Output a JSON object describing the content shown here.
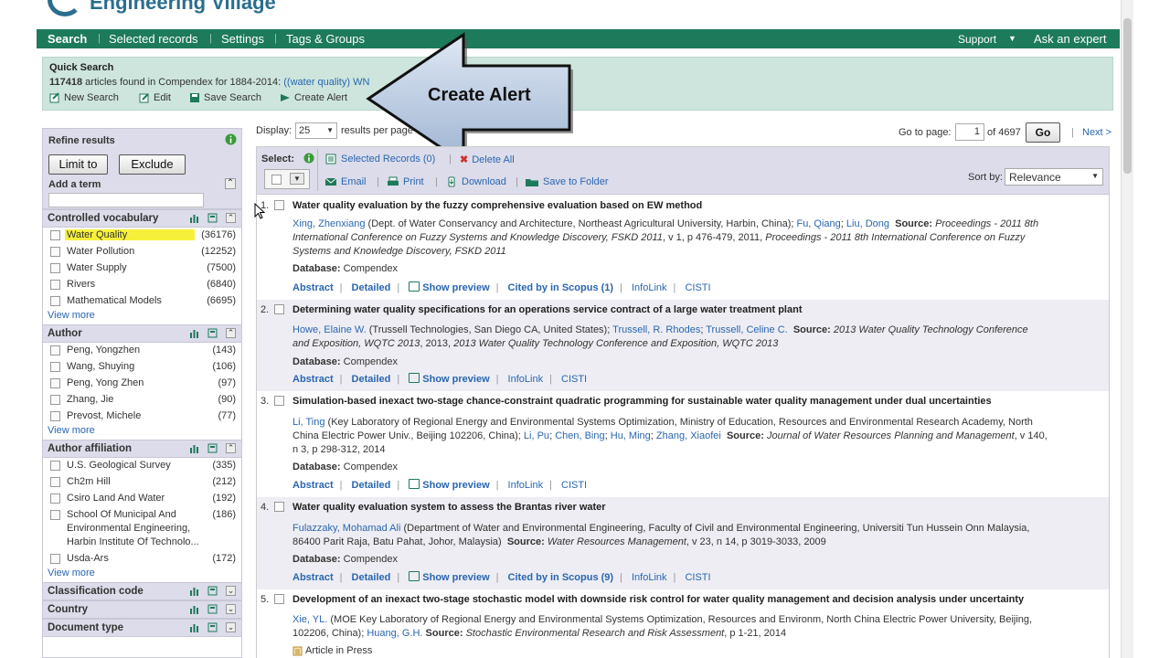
{
  "app": {
    "title": "Engineering Village"
  },
  "nav": {
    "items": [
      "Search",
      "Selected records",
      "Settings",
      "Tags & Groups"
    ],
    "support": "Support",
    "ask": "Ask an expert"
  },
  "quick_search": {
    "title": "Quick Search",
    "count": "117418",
    "count_text": "articles found in Compendex for 1884-2014:",
    "query": "((water quality) WN",
    "tools": [
      "New Search",
      "Edit",
      "Save Search",
      "Create Alert"
    ]
  },
  "callout": {
    "label": "Create Alert"
  },
  "refine": {
    "title": "Refine results",
    "limit": "Limit to",
    "exclude": "Exclude",
    "add_term": "Add a term",
    "view_more": "View more",
    "facets": [
      {
        "title": "Controlled vocabulary",
        "items": [
          {
            "label": "Water Quality",
            "count": "(36176)"
          },
          {
            "label": "Water Pollution",
            "count": "(12252)"
          },
          {
            "label": "Water Supply",
            "count": "(7500)"
          },
          {
            "label": "Rivers",
            "count": "(6840)"
          },
          {
            "label": "Mathematical Models",
            "count": "(6695)"
          }
        ]
      },
      {
        "title": "Author",
        "items": [
          {
            "label": "Peng, Yongzhen",
            "count": "(143)"
          },
          {
            "label": "Wang, Shuying",
            "count": "(106)"
          },
          {
            "label": "Peng, Yong Zhen",
            "count": "(97)"
          },
          {
            "label": "Zhang, Jie",
            "count": "(90)"
          },
          {
            "label": "Prevost, Michele",
            "count": "(77)"
          }
        ]
      },
      {
        "title": "Author affiliation",
        "items": [
          {
            "label": "U.S. Geological Survey",
            "count": "(335)"
          },
          {
            "label": "Ch2m Hill",
            "count": "(212)"
          },
          {
            "label": "Csiro Land And Water",
            "count": "(192)"
          },
          {
            "label": "School Of Municipal And",
            "label2": "Environmental Engineering,",
            "label3": "Harbin Institute Of Technolo...",
            "count": "(186)"
          },
          {
            "label": "Usda-Ars",
            "count": "(172)"
          }
        ]
      },
      {
        "title": "Classification code"
      },
      {
        "title": "Country"
      },
      {
        "title": "Document type"
      }
    ]
  },
  "display": {
    "label": "Display:",
    "value": "25",
    "suffix": "results per page",
    "goto_label": "Go to page:",
    "page": "1",
    "of": "of 4697",
    "go": "Go",
    "next": "Next >"
  },
  "toolbar": {
    "select": "Select:",
    "selected_records": "Selected Records (0)",
    "delete_all": "Delete All",
    "email": "Email",
    "print": "Print",
    "download": "Download",
    "save_folder": "Save to Folder",
    "sort_label": "Sort by:",
    "sort_value": "Relevance"
  },
  "results": [
    {
      "num": "1.",
      "title": "Water quality evaluation by the fuzzy comprehensive evaluation based on EW method",
      "author_line1_link": "Xing, Zhenxiang",
      "author_line1_rest": " (Dept. of Water Conservancy and Architecture, Northeast Agricultural University, Harbin, China); ",
      "author_line1_link2": "Fu, Qiang",
      "author_line1_link3": "Liu, Dong",
      "source_label": "Source:",
      "source_line1": "Proceedings - 2011 8th",
      "source_line2": "International Conference on Fuzzy Systems and Knowledge Discovery, FSKD 2011",
      "source_line2_rest": ", v 1, p 476-479, 2011,",
      "source_line2_it": "Proceedings - 2011 8th International Conference on Fuzzy",
      "source_line3": "Systems and Knowledge Discovery, FSKD 2011",
      "db_label": "Database:",
      "db": "Compendex",
      "actions": [
        "Abstract",
        "Detailed",
        "Show preview",
        "Cited by in Scopus (1)",
        "InfoLink",
        "CISTI"
      ]
    },
    {
      "num": "2.",
      "title": "Determining water quality specifications for an operations service contract of a large water treatment plant",
      "a1": "Howe, Elaine W.",
      "a1_rest": " (Trussell Technologies, San Diego CA, United States); ",
      "a2": "Trussell, R. Rhodes",
      "a3": "Trussell, Celine C.",
      "source_label": "Source:",
      "source_it": "2013 Water Quality Technology Conference",
      "source_line2": "and Exposition, WQTC 2013",
      "source_line2_rest": ", 2013,",
      "source_line2_it": "2013 Water Quality Technology Conference and Exposition, WQTC 2013",
      "db_label": "Database:",
      "db": "Compendex",
      "actions": [
        "Abstract",
        "Detailed",
        "Show preview",
        "InfoLink",
        "CISTI"
      ]
    },
    {
      "num": "3.",
      "title": "Simulation-based inexact two-stage chance-constraint quadratic programming for sustainable water quality management under dual uncertainties",
      "a1": "Li, Ting",
      "a1_rest": " (Key Laboratory of Regional Energy and Environmental Systems Optimization, Ministry of Education, Resources and Environmental Research Academy, North",
      "line2_pre": "China Electric Power Univ., Beijing 102206, China); ",
      "a2": "Li, Pu",
      "a3": "Chen, Bing",
      "a4": "Hu, Ming",
      "a5": "Zhang, Xiaofei",
      "source_label": "Source:",
      "source_it": "Journal of Water Resources Planning and Management",
      "source_rest": ", v 140,",
      "line3": "n 3, p 298-312, 2014",
      "db_label": "Database:",
      "db": "Compendex",
      "actions": [
        "Abstract",
        "Detailed",
        "Show preview",
        "InfoLink",
        "CISTI"
      ]
    },
    {
      "num": "4.",
      "title": "Water quality evaluation system to assess the Brantas river water",
      "a1": "Fulazzaky, Mohamad Ali",
      "a1_rest": " (Department of Water and Environmental Engineering, Faculty of Civil and Environmental Engineering, Universiti Tun Hussein Onn Malaysia,",
      "line2_pre": "86400 Parit Raja, Batu Pahat, Johor, Malaysia) ",
      "source_label": "Source:",
      "source_it": "Water Resources Management",
      "source_rest": ", v 23, n 14, p 3019-3033, 2009",
      "db_label": "Database:",
      "db": "Compendex",
      "actions": [
        "Abstract",
        "Detailed",
        "Show preview",
        "Cited by in Scopus (9)",
        "InfoLink",
        "CISTI"
      ]
    },
    {
      "num": "5.",
      "title": "Development of an inexact two-stage stochastic model with downside risk control for water quality management and decision analysis under uncertainty",
      "a1": "Xie, YL.",
      "a1_rest": " (MOE Key Laboratory of Regional Energy and Environmental Systems Optimization, Resources and Environm, North China Electric Power University, Beijing,",
      "line2_pre": "102206, China); ",
      "a2": "Huang, G.H.",
      "source_label": "Source:",
      "source_it": "Stochastic Environmental Research and Risk Assessment",
      "source_rest": ", p 1-21, 2014",
      "note": "Article in Press"
    }
  ]
}
